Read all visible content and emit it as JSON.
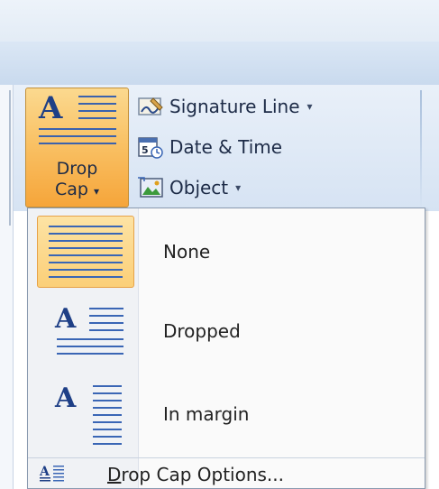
{
  "ribbon": {
    "drop_cap": {
      "label_line1": "Drop",
      "label_line2": "Cap",
      "arrow": "▾",
      "icon": "drop-cap-icon"
    },
    "signature_line": {
      "label": "Signature Line",
      "arrow": "▾",
      "icon": "signature-line-icon"
    },
    "date_time": {
      "label": "Date & Time",
      "icon": "date-time-icon"
    },
    "object": {
      "label": "Object",
      "arrow": "▾",
      "icon": "object-icon"
    }
  },
  "menu": {
    "items": [
      {
        "label": "None",
        "selected": true,
        "icon": "drop-cap-none-icon"
      },
      {
        "label": "Dropped",
        "selected": false,
        "icon": "drop-cap-dropped-icon"
      },
      {
        "label": "In margin",
        "selected": false,
        "icon": "drop-cap-in-margin-icon"
      }
    ],
    "options": {
      "label_first": "D",
      "label_rest": "rop Cap Options...",
      "icon": "drop-cap-options-icon"
    }
  },
  "colors": {
    "selected_fill": "#fbcf78",
    "selected_border": "#e7a248",
    "accent_blue": "#1e3f86"
  }
}
